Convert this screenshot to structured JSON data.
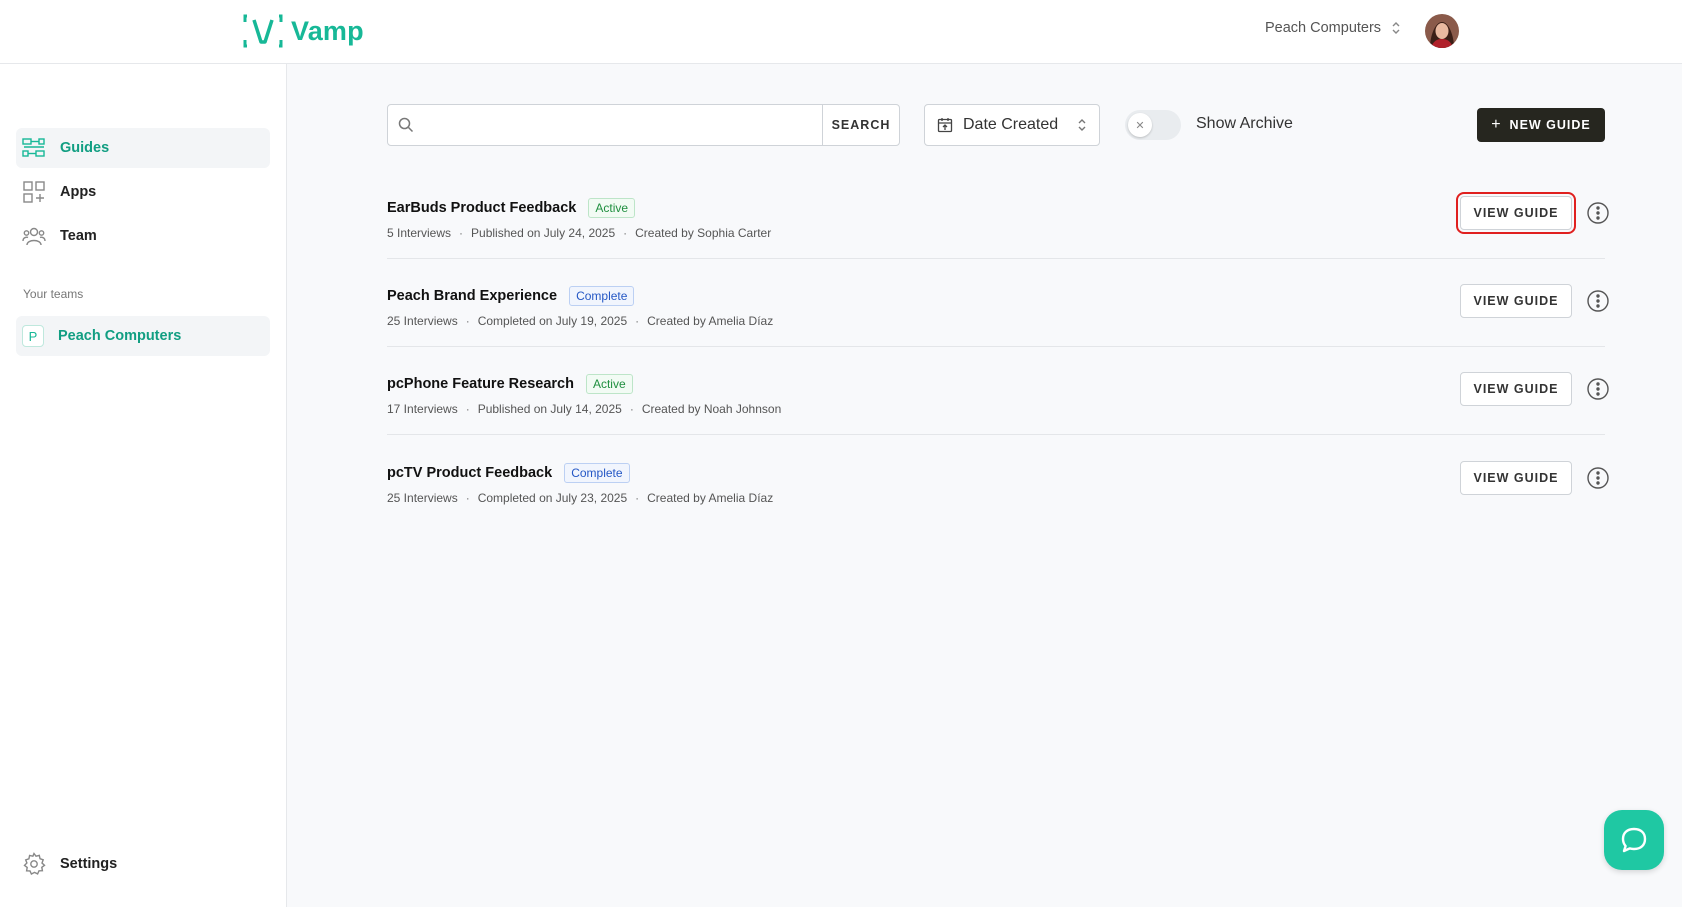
{
  "header": {
    "logo_text": "Vamp",
    "org_name": "Peach Computers"
  },
  "sidebar": {
    "items": [
      {
        "label": "Guides",
        "icon": "guides-icon"
      },
      {
        "label": "Apps",
        "icon": "apps-icon"
      },
      {
        "label": "Team",
        "icon": "team-icon"
      }
    ],
    "teams_label": "Your teams",
    "team": {
      "badge": "P",
      "label": "Peach Computers"
    },
    "settings_label": "Settings"
  },
  "toolbar": {
    "search_placeholder": "",
    "search_button": "SEARCH",
    "sort_label": "Date Created",
    "archive_label": "Show Archive",
    "archive_on": false,
    "new_guide_label": "NEW GUIDE"
  },
  "guides": [
    {
      "title": "EarBuds Product Feedback",
      "status": "Active",
      "interviews": "5 Interviews",
      "date": "Published on July 24, 2025",
      "creator": "Created by Sophia Carter",
      "button": "VIEW GUIDE"
    },
    {
      "title": "Peach Brand Experience",
      "status": "Complete",
      "interviews": "25 Interviews",
      "date": "Completed on July 19, 2025",
      "creator": "Created by Amelia Díaz",
      "button": "VIEW GUIDE"
    },
    {
      "title": "pcPhone Feature Research",
      "status": "Active",
      "interviews": "17 Interviews",
      "date": "Published on July 14, 2025",
      "creator": "Created by Noah Johnson",
      "button": "VIEW GUIDE"
    },
    {
      "title": "pcTV Product Feedback",
      "status": "Complete",
      "interviews": "25 Interviews",
      "date": "Completed on July 23, 2025",
      "creator": "Created by Amelia Díaz",
      "button": "VIEW GUIDE"
    }
  ],
  "colors": {
    "brand": "#17b897",
    "primary_button": "#26261f",
    "highlight": "#e0201f",
    "chat": "#1fc8a3"
  }
}
